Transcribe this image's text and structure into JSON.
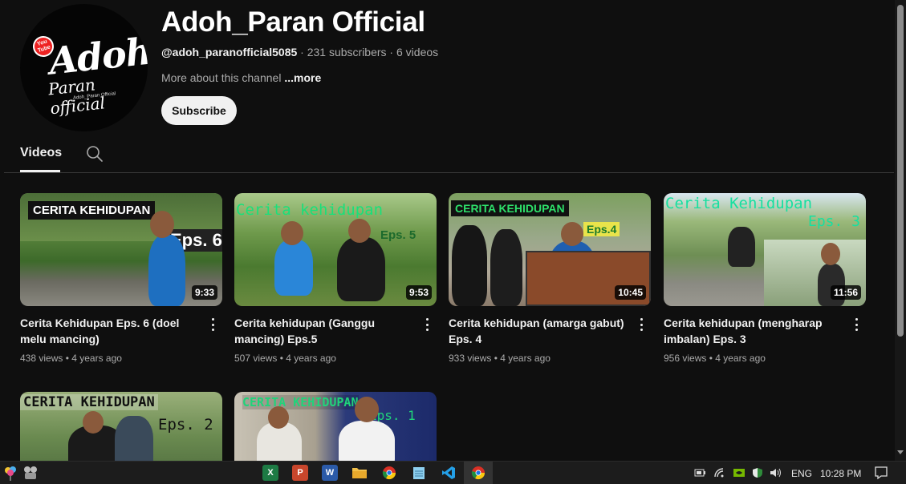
{
  "channel": {
    "name": "Adoh_Paran Official",
    "handle": "@adoh_paranofficial5085",
    "separator": " · ",
    "subscribers": "231 subscribers",
    "videos_count": "6 videos",
    "about": "More about this channel",
    "more": "...more",
    "subscribe_label": "Subscribe",
    "avatar_logo_top": "You",
    "avatar_logo_bottom": "Tube",
    "avatar_text_1": "Adoh",
    "avatar_text_2": "Paran official",
    "avatar_text_3": "Adoh_Paran Official"
  },
  "tabs": {
    "videos": "Videos"
  },
  "videos": [
    {
      "title": "Cerita Kehidupan Eps. 6 (doel melu mancing)",
      "views": "438 views",
      "age": "4 years ago",
      "duration": "9:33",
      "thumb_title": "CERITA KEHIDUPAN",
      "thumb_eps": "Eps. 6"
    },
    {
      "title": "Cerita kehidupan (Ganggu mancing) Eps.5",
      "views": "507 views",
      "age": "4 years ago",
      "duration": "9:53",
      "thumb_title": "Cerita kehidupan",
      "thumb_eps": "Eps. 5"
    },
    {
      "title": "Cerita kehidupan (amarga gabut) Eps. 4",
      "views": "933 views",
      "age": "4 years ago",
      "duration": "10:45",
      "thumb_title": "CERITA KEHIDUPAN",
      "thumb_eps": "Eps.4"
    },
    {
      "title": "Cerita kehidupan (mengharap imbalan) Eps. 3",
      "views": "956 views",
      "age": "4 years ago",
      "duration": "11:56",
      "thumb_title": "Cerita Kehidupan",
      "thumb_eps": "Eps. 3"
    },
    {
      "title": "",
      "views": "",
      "age": "",
      "duration": "",
      "thumb_title": "CERITA KEHIDUPAN",
      "thumb_eps": "Eps. 2"
    },
    {
      "title": "",
      "views": "",
      "age": "",
      "duration": "",
      "thumb_title": "CERITA KEHIDUPAN",
      "thumb_eps": "Eps. 1"
    }
  ],
  "meta_separator": " • ",
  "taskbar": {
    "apps": [
      "excel-icon",
      "powerpoint-icon",
      "word-icon",
      "file-explorer-icon",
      "chrome-icon",
      "notepad-icon",
      "vscode-icon",
      "chrome-icon"
    ],
    "language": "ENG",
    "time": "10:28 PM"
  },
  "colors": {
    "background": "#0f0f0f",
    "text": "#f1f1f1",
    "muted": "#aaaaaa",
    "subscribe_bg": "#f1f1f1"
  }
}
